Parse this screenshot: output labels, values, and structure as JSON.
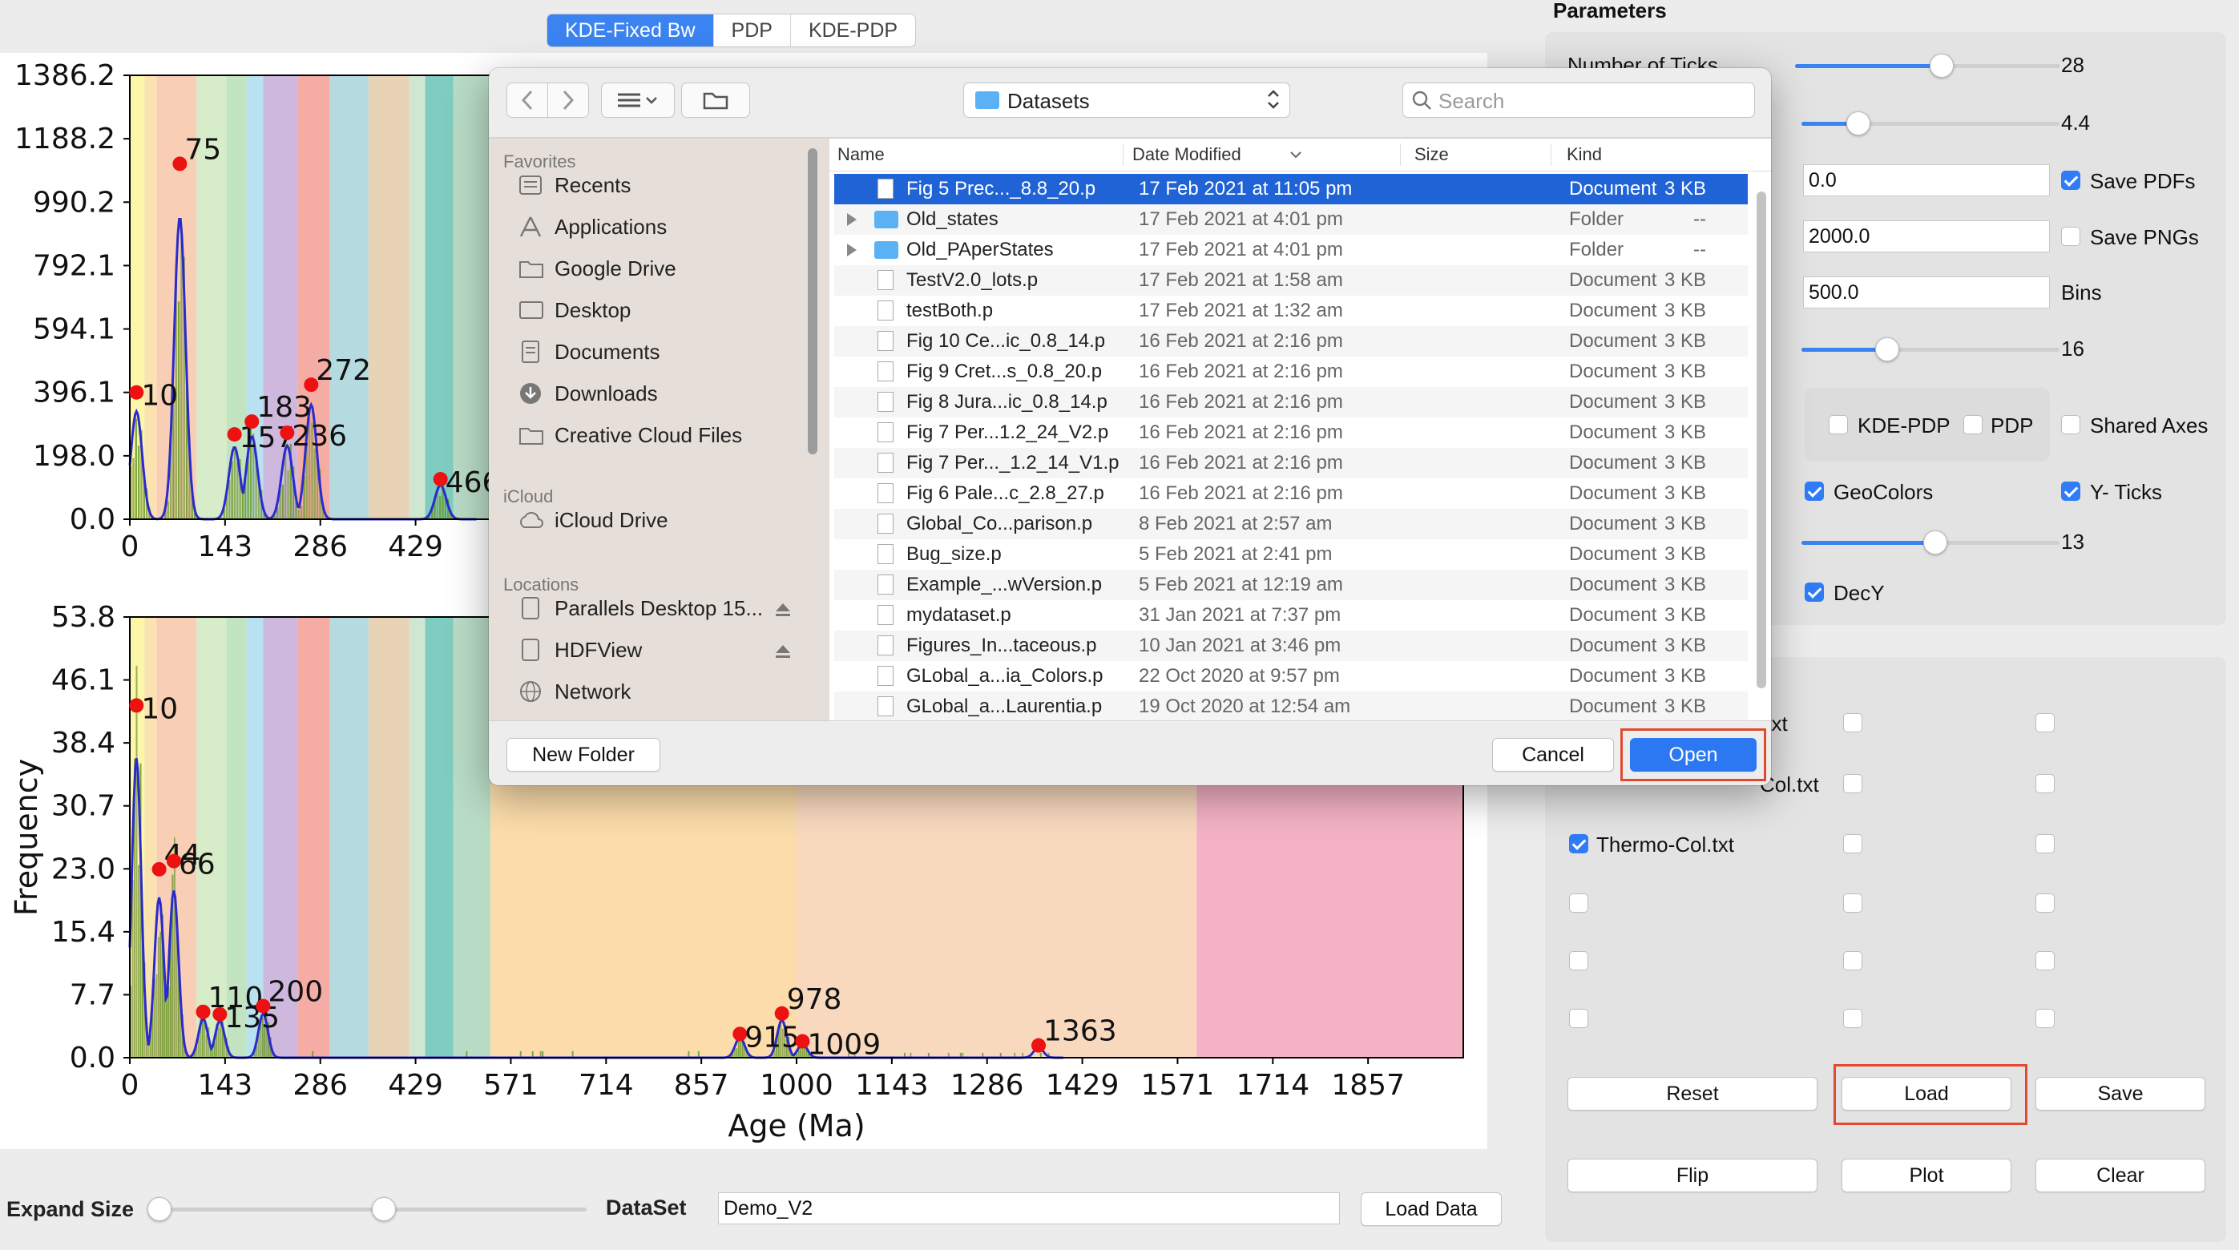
{
  "tabs": [
    {
      "label": "KDE-Fixed Bw",
      "active": true
    },
    {
      "label": "PDP",
      "active": false
    },
    {
      "label": "KDE-PDP",
      "active": false
    }
  ],
  "chart_data": [
    {
      "type": "bar",
      "xlim": [
        0,
        2000
      ],
      "ylim": [
        0,
        1386.2
      ],
      "yticks": [
        "1386.2",
        "1188.2",
        "990.2",
        "792.1",
        "594.1",
        "396.1",
        "198.0",
        "0.0"
      ],
      "xticks": [
        "0",
        "143",
        "286",
        "429"
      ],
      "bands": [
        {
          "x0": 0,
          "x1": 22,
          "color": "#fbf6a8"
        },
        {
          "x0": 22,
          "x1": 40,
          "color": "#fbe3b0"
        },
        {
          "x0": 40,
          "x1": 100,
          "color": "#f8cfb5"
        },
        {
          "x0": 100,
          "x1": 145,
          "color": "#d7ecc8"
        },
        {
          "x0": 145,
          "x1": 175,
          "color": "#c2e4c0"
        },
        {
          "x0": 175,
          "x1": 200,
          "color": "#b9e2f0"
        },
        {
          "x0": 200,
          "x1": 252,
          "color": "#cfb8de"
        },
        {
          "x0": 252,
          "x1": 300,
          "color": "#f4aca4"
        },
        {
          "x0": 300,
          "x1": 358,
          "color": "#b5dbe0"
        },
        {
          "x0": 358,
          "x1": 419,
          "color": "#e9d3b7"
        },
        {
          "x0": 419,
          "x1": 443,
          "color": "#cfe6d0"
        },
        {
          "x0": 443,
          "x1": 485,
          "color": "#7fcdc0"
        },
        {
          "x0": 485,
          "x1": 541,
          "color": "#b9dcc6"
        },
        {
          "x0": 541,
          "x1": 1000,
          "color": "#fbdcaa"
        },
        {
          "x0": 1000,
          "x1": 1600,
          "color": "#f8d9be"
        },
        {
          "x0": 1600,
          "x1": 2000,
          "color": "#f4b2c4"
        }
      ],
      "peaks": [
        {
          "x": 10,
          "y": 396,
          "label": "10"
        },
        {
          "x": 75,
          "y": 1110,
          "label": "75"
        },
        {
          "x": 157,
          "y": 265,
          "label": "157"
        },
        {
          "x": 183,
          "y": 305,
          "label": "183"
        },
        {
          "x": 236,
          "y": 270,
          "label": "236"
        },
        {
          "x": 272,
          "y": 420,
          "label": "272"
        },
        {
          "x": 466,
          "y": 125,
          "label": "466"
        }
      ]
    },
    {
      "type": "bar",
      "xlim": [
        0,
        2000
      ],
      "ylim": [
        0,
        53.8
      ],
      "ylabel": "Frequency",
      "xlabel": "Age (Ma)",
      "yticks": [
        "53.8",
        "46.1",
        "38.4",
        "30.7",
        "23.0",
        "15.4",
        "7.7",
        "0.0"
      ],
      "xticks": [
        "0",
        "143",
        "286",
        "429",
        "571",
        "714",
        "857",
        "1000",
        "1143",
        "1286",
        "1429",
        "1571",
        "1714",
        "1857"
      ],
      "bands": [
        {
          "x0": 0,
          "x1": 22,
          "color": "#fbf6a8"
        },
        {
          "x0": 22,
          "x1": 40,
          "color": "#fbe3b0"
        },
        {
          "x0": 40,
          "x1": 100,
          "color": "#f8cfb5"
        },
        {
          "x0": 100,
          "x1": 145,
          "color": "#d7ecc8"
        },
        {
          "x0": 145,
          "x1": 175,
          "color": "#c2e4c0"
        },
        {
          "x0": 175,
          "x1": 200,
          "color": "#b9e2f0"
        },
        {
          "x0": 200,
          "x1": 252,
          "color": "#cfb8de"
        },
        {
          "x0": 252,
          "x1": 300,
          "color": "#f4aca4"
        },
        {
          "x0": 300,
          "x1": 358,
          "color": "#b5dbe0"
        },
        {
          "x0": 358,
          "x1": 419,
          "color": "#e9d3b7"
        },
        {
          "x0": 419,
          "x1": 443,
          "color": "#cfe6d0"
        },
        {
          "x0": 443,
          "x1": 485,
          "color": "#7fcdc0"
        },
        {
          "x0": 485,
          "x1": 541,
          "color": "#b9dcc6"
        },
        {
          "x0": 541,
          "x1": 1000,
          "color": "#fbdcaa"
        },
        {
          "x0": 1000,
          "x1": 1600,
          "color": "#f8d9be"
        },
        {
          "x0": 1600,
          "x1": 2000,
          "color": "#f4b2c4"
        }
      ],
      "peaks": [
        {
          "x": 10,
          "y": 43,
          "label": "10"
        },
        {
          "x": 44,
          "y": 23,
          "label": "44"
        },
        {
          "x": 66,
          "y": 24,
          "label": "66"
        },
        {
          "x": 110,
          "y": 5.6,
          "label": "110"
        },
        {
          "x": 135,
          "y": 5.3,
          "label": "135"
        },
        {
          "x": 200,
          "y": 6.3,
          "label": "200"
        },
        {
          "x": 915,
          "y": 2.9,
          "label": "915"
        },
        {
          "x": 978,
          "y": 5.4,
          "label": "978"
        },
        {
          "x": 1009,
          "y": 2,
          "label": "1009"
        },
        {
          "x": 1363,
          "y": 1.5,
          "label": "1363"
        }
      ]
    }
  ],
  "bottom": {
    "expand_label": "Expand Size",
    "dataset_label": "DataSet",
    "dataset_value": "Demo_V2",
    "load_data": "Load Data"
  },
  "right": {
    "title": "Parameters",
    "num_ticks_label": "Number of Ticks",
    "num_ticks_value": "28",
    "slider2_value": "4.4",
    "field1": "0.0",
    "field2": "2000.0",
    "field3": "500.0",
    "bins_label": "Bins",
    "save_pdfs": "Save PDFs",
    "save_pngs": "Save PNGs",
    "slider3_value": "16",
    "kde_pdp": "KDE-PDP",
    "pdp": "PDP",
    "shared_axes": "Shared Axes",
    "geocolors": "GeoColors",
    "y_ticks": "Y- Ticks",
    "slider4_value": "13",
    "decy": "DecY",
    "file1": ".txt",
    "file2": "Col.txt",
    "file3": "Thermo-Col.txt",
    "reset": "Reset",
    "load": "Load",
    "save": "Save",
    "flip": "Flip",
    "plot": "Plot",
    "clear": "Clear"
  },
  "dialog": {
    "location": "Datasets",
    "search_placeholder": "Search",
    "favorites_header": "Favorites",
    "favorites": [
      "Recents",
      "Applications",
      "Google Drive",
      "Desktop",
      "Documents",
      "Downloads",
      "Creative Cloud Files"
    ],
    "icloud_header": "iCloud",
    "icloud": [
      "iCloud Drive"
    ],
    "locations_header": "Locations",
    "locations": [
      "Parallels Desktop 15...",
      "HDFView",
      "Network"
    ],
    "columns": {
      "name": "Name",
      "date": "Date Modified",
      "size": "Size",
      "kind": "Kind"
    },
    "files": [
      {
        "name": "Fig 5 Prec..._8.8_20.p",
        "date": "17 Feb 2021 at 11:05 pm",
        "size": "3 KB",
        "kind": "Document",
        "folder": false,
        "selected": true
      },
      {
        "name": "Old_states",
        "date": "17 Feb 2021 at 4:01 pm",
        "size": "--",
        "kind": "Folder",
        "folder": true
      },
      {
        "name": "Old_PAperStates",
        "date": "17 Feb 2021 at 4:01 pm",
        "size": "--",
        "kind": "Folder",
        "folder": true
      },
      {
        "name": "TestV2.0_lots.p",
        "date": "17 Feb 2021 at 1:58 am",
        "size": "3 KB",
        "kind": "Document",
        "folder": false
      },
      {
        "name": "testBoth.p",
        "date": "17 Feb 2021 at 1:32 am",
        "size": "3 KB",
        "kind": "Document",
        "folder": false
      },
      {
        "name": "Fig 10 Ce...ic_0.8_14.p",
        "date": "16 Feb 2021 at 2:16 pm",
        "size": "3 KB",
        "kind": "Document",
        "folder": false
      },
      {
        "name": "Fig 9 Cret...s_0.8_20.p",
        "date": "16 Feb 2021 at 2:16 pm",
        "size": "3 KB",
        "kind": "Document",
        "folder": false
      },
      {
        "name": "Fig 8 Jura...ic_0.8_14.p",
        "date": "16 Feb 2021 at 2:16 pm",
        "size": "3 KB",
        "kind": "Document",
        "folder": false
      },
      {
        "name": "Fig 7 Per...1.2_24_V2.p",
        "date": "16 Feb 2021 at 2:16 pm",
        "size": "3 KB",
        "kind": "Document",
        "folder": false
      },
      {
        "name": "Fig 7 Per..._1.2_14_V1.p",
        "date": "16 Feb 2021 at 2:16 pm",
        "size": "3 KB",
        "kind": "Document",
        "folder": false
      },
      {
        "name": "Fig 6 Pale...c_2.8_27.p",
        "date": "16 Feb 2021 at 2:16 pm",
        "size": "3 KB",
        "kind": "Document",
        "folder": false
      },
      {
        "name": "Global_Co...parison.p",
        "date": "8 Feb 2021 at 2:57 am",
        "size": "3 KB",
        "kind": "Document",
        "folder": false
      },
      {
        "name": "Bug_size.p",
        "date": "5 Feb 2021 at 2:41 pm",
        "size": "3 KB",
        "kind": "Document",
        "folder": false
      },
      {
        "name": "Example_...wVersion.p",
        "date": "5 Feb 2021 at 12:19 am",
        "size": "3 KB",
        "kind": "Document",
        "folder": false
      },
      {
        "name": "mydataset.p",
        "date": "31 Jan 2021 at 7:37 pm",
        "size": "3 KB",
        "kind": "Document",
        "folder": false
      },
      {
        "name": "Figures_In...taceous.p",
        "date": "10 Jan 2021 at 3:46 pm",
        "size": "3 KB",
        "kind": "Document",
        "folder": false
      },
      {
        "name": "GLobal_a...ia_Colors.p",
        "date": "22 Oct 2020 at 9:57 pm",
        "size": "3 KB",
        "kind": "Document",
        "folder": false
      },
      {
        "name": "GLobal_a...Laurentia.p",
        "date": "19 Oct 2020 at 12:54 am",
        "size": "3 KB",
        "kind": "Document",
        "folder": false
      }
    ],
    "new_folder": "New Folder",
    "cancel": "Cancel",
    "open": "Open"
  }
}
